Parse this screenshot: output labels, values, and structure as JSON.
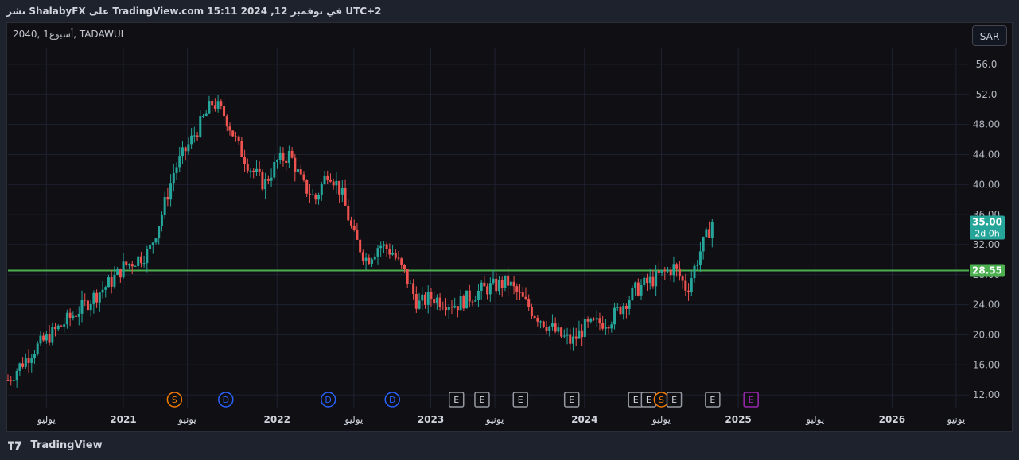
{
  "header": {
    "publish_text": "نشر ShalabyFX على TradingView.com 15:11 2024 ,12 في نوفمبر UTC+2"
  },
  "symbol_label": "2040, 1أسبوع, TADAWUL",
  "currency_button": "SAR",
  "footer": {
    "brand": "TradingView"
  },
  "colors": {
    "up": "#26a69a",
    "down": "#ef5350",
    "support_line": "#4caf50",
    "price_label": "#26a69a",
    "dividend": "#2962ff",
    "split": "#f57c00",
    "earnings": "#9598a1",
    "earnings_future": "#9c27b0"
  },
  "chart_data": {
    "type": "candlestick",
    "x_start": "2020-04",
    "x_end": "2026-07",
    "ylim": [
      10.0,
      58.0
    ],
    "y_ticks": [
      "56.0",
      "52.0",
      "48.00",
      "44.00",
      "40.00",
      "36.00",
      "32.00",
      "28.00",
      "24.00",
      "20.00",
      "16.00",
      "12.00"
    ],
    "x_ticks": [
      "يوليو",
      "2021",
      "يونيو",
      "2022",
      "يوليو",
      "2023",
      "يونيو",
      "2024",
      "يوليو",
      "2025",
      "يوليو",
      "2026",
      "يونيو"
    ],
    "price_path": [
      [
        "2020-04",
        14
      ],
      [
        "2020-06",
        18
      ],
      [
        "2020-08",
        21
      ],
      [
        "2020-10",
        24
      ],
      [
        "2020-12",
        27
      ],
      [
        "2021-01",
        29
      ],
      [
        "2021-02",
        30
      ],
      [
        "2021-03",
        31
      ],
      [
        "2021-04",
        36
      ],
      [
        "2021-05",
        42
      ],
      [
        "2021-06",
        45
      ],
      [
        "2021-07",
        48
      ],
      [
        "2021-08",
        51
      ],
      [
        "2021-09",
        49
      ],
      [
        "2021-10",
        45
      ],
      [
        "2021-11",
        42
      ],
      [
        "2021-12",
        40
      ],
      [
        "2022-01",
        43
      ],
      [
        "2022-02",
        44
      ],
      [
        "2022-03",
        40
      ],
      [
        "2022-04",
        38
      ],
      [
        "2022-05",
        42
      ],
      [
        "2022-06",
        39
      ],
      [
        "2022-07",
        33
      ],
      [
        "2022-08",
        30
      ],
      [
        "2022-09",
        32
      ],
      [
        "2022-10",
        31
      ],
      [
        "2022-11",
        28
      ],
      [
        "2022-12",
        24
      ],
      [
        "2023-01",
        25
      ],
      [
        "2023-03",
        24
      ],
      [
        "2023-05",
        26
      ],
      [
        "2023-07",
        27
      ],
      [
        "2023-09",
        23
      ],
      [
        "2023-11",
        20
      ],
      [
        "2023-12",
        19
      ],
      [
        "2024-01",
        21
      ],
      [
        "2024-03",
        22
      ],
      [
        "2024-05",
        26
      ],
      [
        "2024-07",
        28
      ],
      [
        "2024-08",
        29
      ],
      [
        "2024-09",
        26
      ],
      [
        "2024-10",
        31
      ],
      [
        "2024-11",
        35
      ]
    ],
    "last_price": "35.00",
    "countdown": "2d 0h",
    "horizontal_line": {
      "value": 28.55,
      "label": "28.55"
    },
    "events": [
      {
        "type": "split",
        "date": "2021-05",
        "label": "S"
      },
      {
        "type": "dividend",
        "date": "2021-09",
        "label": "D"
      },
      {
        "type": "dividend",
        "date": "2022-05",
        "label": "D"
      },
      {
        "type": "dividend",
        "date": "2022-10",
        "label": "D"
      },
      {
        "type": "earnings",
        "date": "2023-03",
        "label": "E"
      },
      {
        "type": "earnings",
        "date": "2023-05",
        "label": "E"
      },
      {
        "type": "earnings",
        "date": "2023-08",
        "label": "E"
      },
      {
        "type": "earnings",
        "date": "2023-12",
        "label": "E"
      },
      {
        "type": "earnings",
        "date": "2024-05",
        "label": "E"
      },
      {
        "type": "earnings",
        "date": "2024-06",
        "label": "E"
      },
      {
        "type": "split",
        "date": "2024-07",
        "label": "S"
      },
      {
        "type": "earnings",
        "date": "2024-08",
        "label": "E"
      },
      {
        "type": "earnings",
        "date": "2024-11",
        "label": "E"
      },
      {
        "type": "earnings_future",
        "date": "2025-02",
        "label": "E"
      }
    ]
  }
}
